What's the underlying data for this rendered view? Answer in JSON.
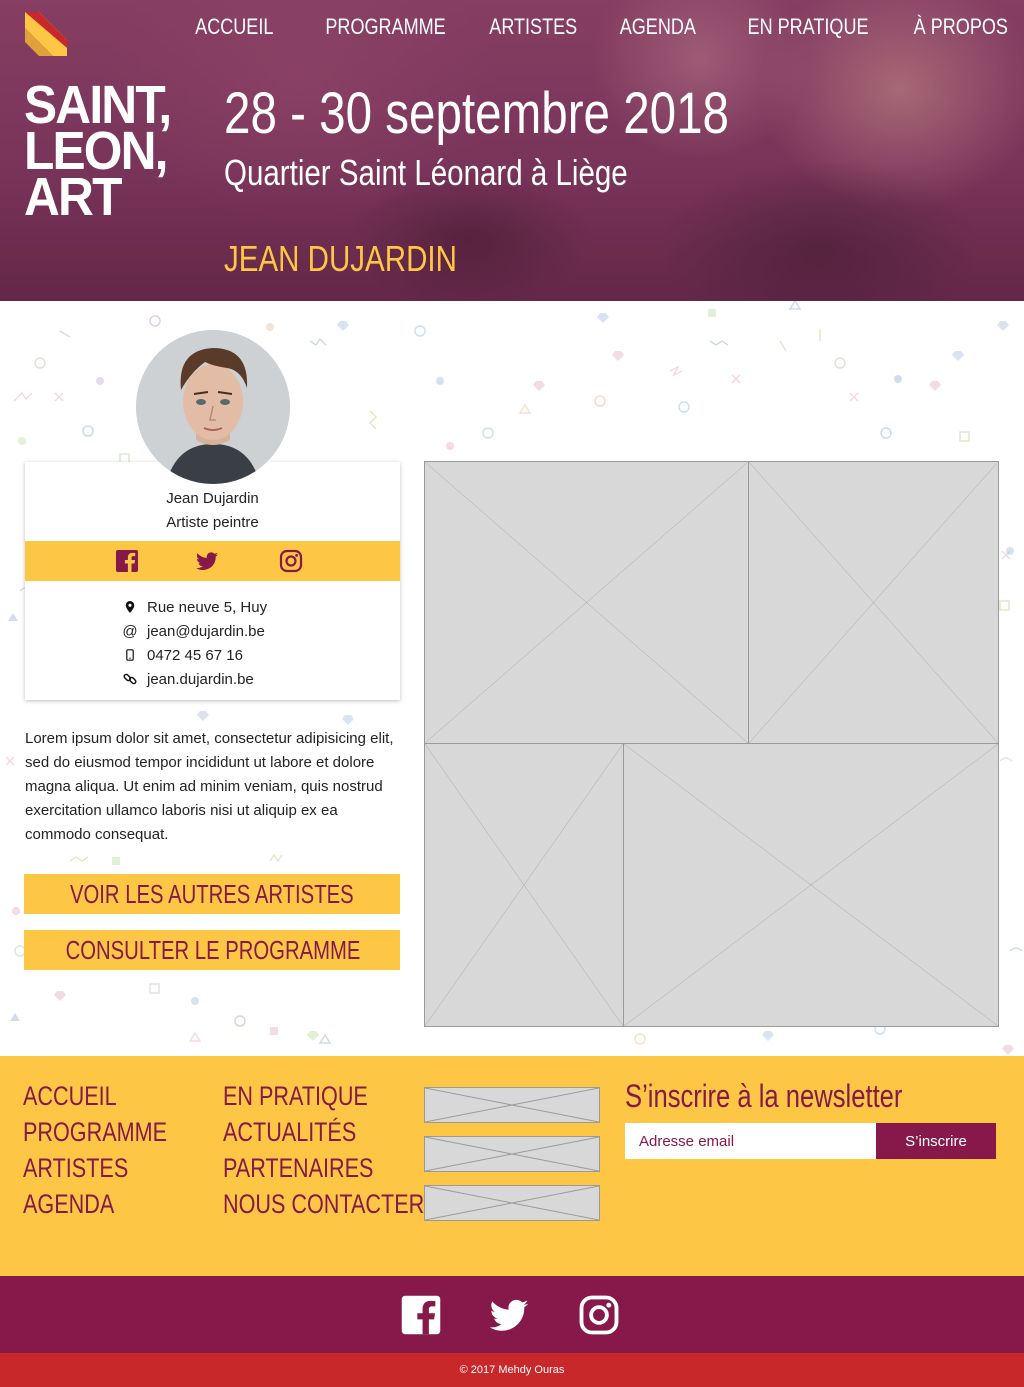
{
  "nav": [
    "ACCUEIL",
    "PROGRAMME",
    "ARTISTES",
    "AGENDA",
    "EN PRATIQUE",
    "À PROPOS"
  ],
  "brand": {
    "line1": "SAINT,",
    "line2": "LEON,",
    "line3": "ART"
  },
  "hero": {
    "dates": "28 - 30 septembre 2018",
    "place": "Quartier Saint Léonard à Liège",
    "artist_title": "JEAN DUJARDIN"
  },
  "profile": {
    "name": "Jean Dujardin",
    "role": "Artiste peintre",
    "social_icons": [
      "facebook-icon",
      "twitter-icon",
      "instagram-icon"
    ],
    "address": "Rue neuve 5, Huy",
    "email": "jean@dujardin.be",
    "phone": "0472 45 67 16",
    "website": "jean.dujardin.be"
  },
  "bio": "Lorem ipsum dolor sit amet, consectetur adipisicing elit, sed do eiusmod tempor incididunt ut labore et dolore magna aliqua. Ut enim ad minim veniam, quis nostrud exercitation ullamco laboris nisi ut aliquip ex ea commodo consequat.",
  "buttons": {
    "other_artists": "VOIR LES AUTRES ARTISTES",
    "program": "CONSULTER LE PROGRAMME"
  },
  "footer": {
    "col1": [
      "ACCUEIL",
      "PROGRAMME",
      "ARTISTES",
      "AGENDA"
    ],
    "col2": [
      "EN PRATIQUE",
      "ACTUALITÉS",
      "PARTENAIRES",
      "NOUS CONTACTER"
    ],
    "newsletter_title": "S’inscrire à la newsletter",
    "email_placeholder": "Adresse email",
    "subscribe_label": "S’inscrire"
  },
  "social_bar": [
    "facebook-icon",
    "twitter-icon",
    "instagram-icon"
  ],
  "copyright": "© 2017 Mehdy Ouras",
  "colors": {
    "primary": "#86194a",
    "accent": "#fdc745",
    "bottom_bar": "#c8282a",
    "placeholder": "#d8d8d8"
  }
}
